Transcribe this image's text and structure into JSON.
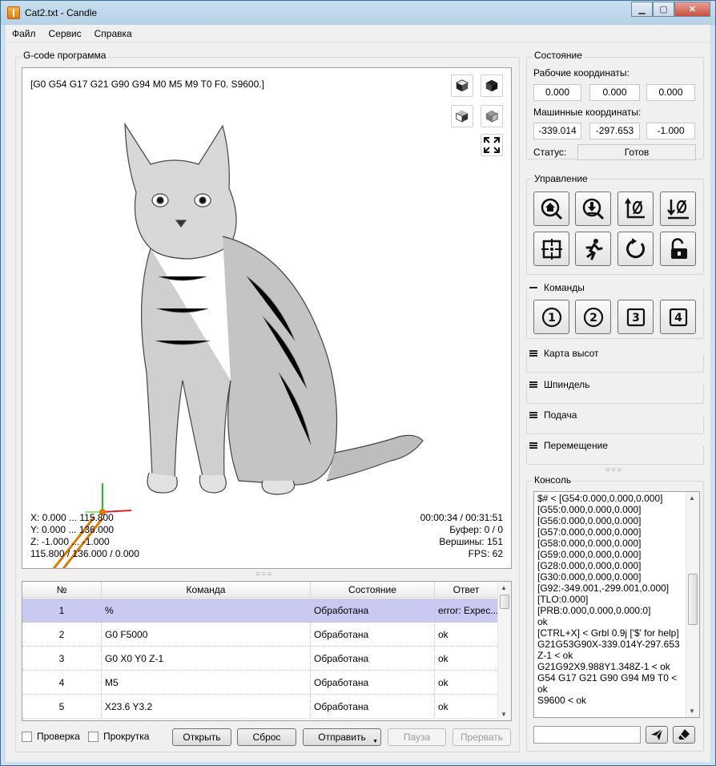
{
  "window": {
    "title": "Cat2.txt - Candle",
    "minimize": "▁",
    "maximize": "▢",
    "close": "✕"
  },
  "menu": [
    "Файл",
    "Сервис",
    "Справка"
  ],
  "gcode": {
    "group_title": "G-code программа",
    "parser_state": "[G0 G54 G17 G21 G90 G94 M0 M5 M9 T0 F0. S9600.]",
    "x_range": "X: 0.000 ... 115.800",
    "y_range": "Y: 0.000 ... 136.000",
    "z_range": "Z: -1.000 ... -1.000",
    "size": "115.800 / 136.000 / 0.000",
    "time": "00:00:34 / 00:31:51",
    "buffer": "Буфер: 0 / 0",
    "vertices": "Вершины: 151",
    "fps": "FPS: 62"
  },
  "splitter_dots": "○○○",
  "table": {
    "headers": [
      "№",
      "Команда",
      "Состояние",
      "Ответ"
    ],
    "rows": [
      {
        "num": "1",
        "cmd": "%",
        "state": "Обработана",
        "resp": "error: Expec..."
      },
      {
        "num": "2",
        "cmd": "G0 F5000",
        "state": "Обработана",
        "resp": "ok"
      },
      {
        "num": "3",
        "cmd": "G0 X0 Y0 Z-1",
        "state": "Обработана",
        "resp": "ok"
      },
      {
        "num": "4",
        "cmd": "M5",
        "state": "Обработана",
        "resp": "ok"
      },
      {
        "num": "5",
        "cmd": "X23.6 Y3.2",
        "state": "Обработана",
        "resp": "ok"
      }
    ]
  },
  "bottom": {
    "check_label": "Проверка",
    "scroll_label": "Прокрутка",
    "open": "Открыть",
    "reset": "Сброс",
    "send": "Отправить",
    "pause": "Пауза",
    "abort": "Прервать"
  },
  "state": {
    "title": "Состояние",
    "work_label": "Рабочие координаты:",
    "work": [
      "0.000",
      "0.000",
      "0.000"
    ],
    "machine_label": "Машинные координаты:",
    "machine": [
      "-339.014",
      "-297.653",
      "-1.000"
    ],
    "status_label": "Статус:",
    "status": "Готов"
  },
  "control": {
    "title": "Управление",
    "buttons": [
      "home-icon",
      "probe-icon",
      "zero-xy-icon",
      "zero-z-icon",
      "origin-icon",
      "safe-position-icon",
      "soft-reset-icon",
      "unlock-icon"
    ]
  },
  "commands": {
    "title": "Команды",
    "buttons": [
      "1",
      "2",
      "3",
      "4"
    ]
  },
  "sections": [
    "Карта высот",
    "Шпиндель",
    "Подача",
    "Перемещение"
  ],
  "console": {
    "title": "Консоль",
    "text": "$# < [G54:0.000,0.000,0.000]\n[G55:0.000,0.000,0.000]\n[G56:0.000,0.000,0.000]\n[G57:0.000,0.000,0.000]\n[G58:0.000,0.000,0.000]\n[G59:0.000,0.000,0.000]\n[G28:0.000,0.000,0.000]\n[G30:0.000,0.000,0.000]\n[G92:-349.001,-299.001,0.000]\n[TLO:0.000]\n[PRB:0.000,0.000,0.000:0]\nok\n[CTRL+X] < Grbl 0.9j ['$' for help]\nG21G53G90X-339.014Y-297.653Z-1 < ok\nG21G92X9.988Y1.348Z-1 < ok\nG54 G17 G21 G90 G94 M9 T0 < ok\nS9600 < ok"
  },
  "colors": {
    "selected_row": "#c9c9f2",
    "tool_color": "#e07a00",
    "x_axis": "#e02020",
    "y_axis": "#20c020"
  }
}
